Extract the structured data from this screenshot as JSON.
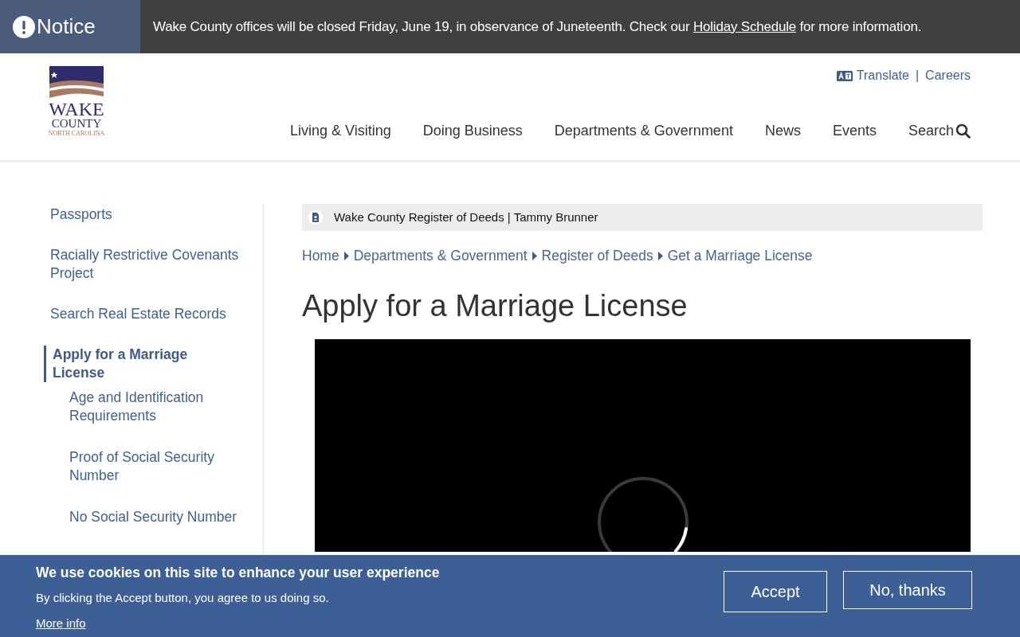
{
  "notice": {
    "label": "Notice",
    "text_before": "Wake County offices will be closed Friday, June 19, in observance of Juneteenth. Check our",
    "link": "Holiday Schedule",
    "text_after": "for more information."
  },
  "logo": {
    "line_1": "WAKE",
    "line_2": "COUNTY",
    "line_3": "NORTH CAROLINA"
  },
  "utility_separator": "|",
  "utility_links": [
    {
      "label": "Translate",
      "kind": "translate"
    },
    {
      "label": "Careers",
      "kind": "plain"
    }
  ],
  "nav": {
    "items": [
      "Living & Visiting",
      "Doing Business",
      "Departments & Government",
      "News",
      "Events"
    ],
    "search_label": "Search"
  },
  "sidebar": {
    "items": [
      {
        "label": "Passports",
        "selected": false
      },
      {
        "label": "Racially Restrictive Covenants Project",
        "selected": false
      },
      {
        "label": "Search Real Estate Records",
        "selected": false
      },
      {
        "label": "Apply for a Marriage License",
        "selected": true,
        "children": [
          {
            "label": "Age and Identification Requirements",
            "selected": false
          },
          {
            "label": "Proof of Social Security Number",
            "selected": false
          },
          {
            "label": "No Social Security Number",
            "selected": false
          }
        ]
      }
    ]
  },
  "department_bar": {
    "text": "Wake County Register of Deeds | Tammy Brunner"
  },
  "breadcrumb": [
    "Home",
    "Departments & Government",
    "Register of Deeds",
    "Get a Marriage License"
  ],
  "page_title": "Apply for a Marriage License",
  "video": {
    "loading": true
  },
  "cookie_banner": {
    "title": "We use cookies on this site to enhance your user experience",
    "text": "By clicking the Accept button, you agree to us doing so.",
    "more_info": "More info",
    "buttons": [
      "Accept",
      "No, thanks"
    ]
  }
}
